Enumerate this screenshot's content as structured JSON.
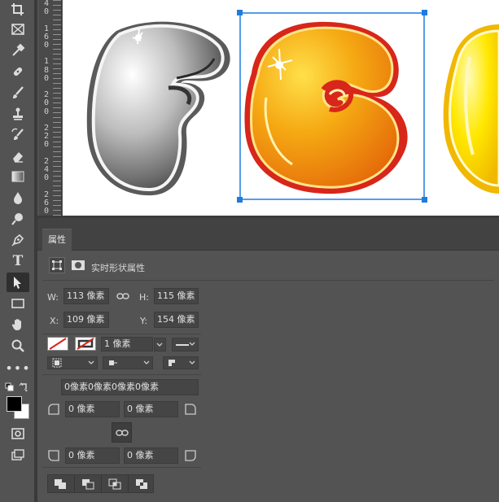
{
  "ruler": {
    "digits": "4\n0\n \n1\n6\n0\n \n1\n8\n0\n \n2\n0\n0\n \n2\n2\n0\n \n2\n4\n0\n \n2\n6\n0"
  },
  "panel": {
    "tab_label": "属性",
    "shape_props_label": "实时形状属性",
    "w_label": "W:",
    "w_value": "113 像素",
    "h_label": "H:",
    "h_value": "115 像素",
    "x_label": "X:",
    "x_value": "109 像素",
    "y_label": "Y:",
    "y_value": "154 像素",
    "stroke_width": "1 像素",
    "corner_all": "0像素0像素0像素0像素",
    "corner_tl": "0 像素",
    "corner_tr": "0 像素",
    "corner_bl": "0 像素",
    "corner_br": "0 像素"
  },
  "colors": {
    "accent_selection": "#1f7be0",
    "orange_letter": "#f2a20d",
    "red_outline": "#d8261a",
    "yellow_letter": "#ffe000"
  },
  "icons": {
    "tools": [
      "crop-icon",
      "frame-icon",
      "eyedropper-icon",
      "healing-brush-icon",
      "brush-icon",
      "clone-stamp-icon",
      "history-brush-icon",
      "eraser-icon",
      "gradient-icon",
      "blur-icon",
      "dodge-icon",
      "pen-icon",
      "type-icon",
      "path-selection-icon",
      "rectangle-icon",
      "hand-icon",
      "zoom-icon",
      "more-tools-icon"
    ]
  }
}
